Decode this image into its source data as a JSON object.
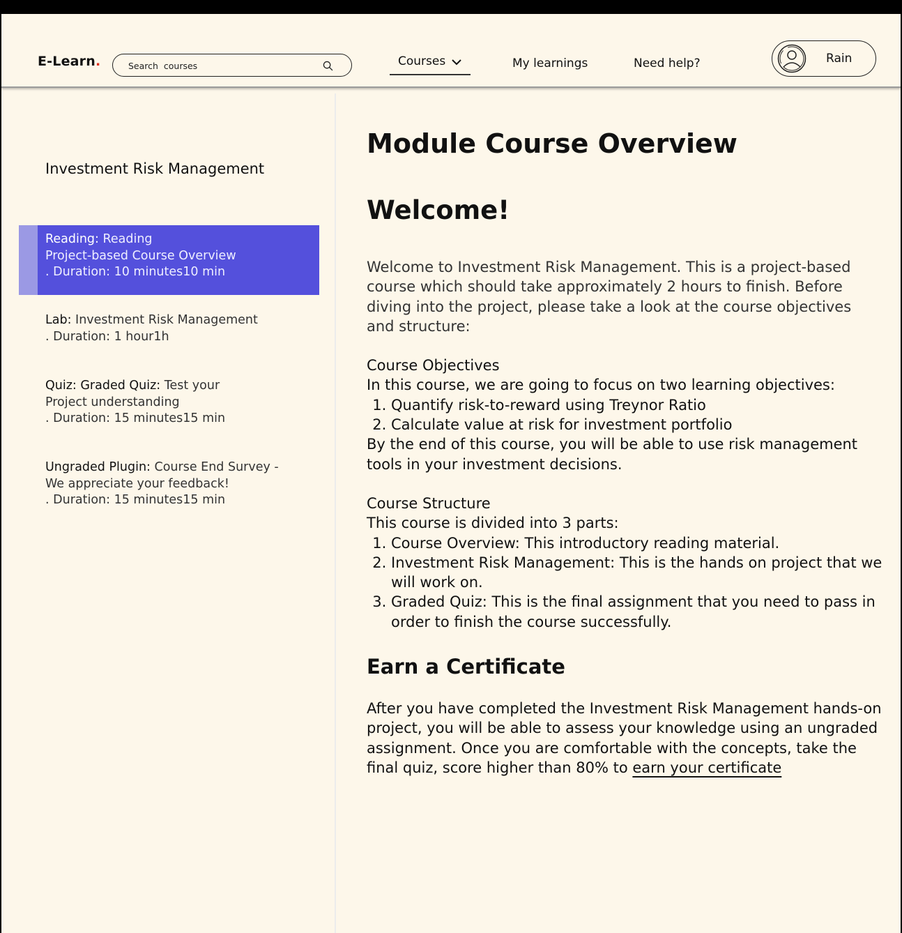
{
  "header": {
    "logo": "E-Learn",
    "logo_dot": ".",
    "search_placeholder": "Search  courses",
    "nav": {
      "courses": "Courses",
      "my_learnings": "My learnings",
      "need_help": "Need help?"
    },
    "user_name": "Rain"
  },
  "sidebar": {
    "course_title": "Investment Risk Management",
    "items": [
      {
        "label": "Reading:",
        "text": " Reading\nProject-based Course Overview\n. Duration: 10 minutes10 min",
        "active": true
      },
      {
        "label": "Lab:",
        "text": " Investment Risk Management\n. Duration: 1 hour1h",
        "active": false
      },
      {
        "label": "Quiz: Graded Quiz:",
        "text": " Test your\nProject understanding\n. Duration: 15 minutes15 min",
        "active": false
      },
      {
        "label": "Ungraded Plugin:",
        "text": " Course End Survey -\n We appreciate your feedback!\n. Duration: 15 minutes15 min",
        "active": false
      }
    ]
  },
  "main": {
    "page_title": "Module Course Overview",
    "welcome_heading": "Welcome!",
    "intro": "Welcome to Investment Risk Management. This is a project-based course which should take approximately 2 hours to finish. Before diving into the project, please take a look at the course objectives and structure:",
    "objectives": {
      "heading": "Course Objectives",
      "lead": "In this course, we are going to focus on two learning objectives:",
      "items": [
        "Quantify risk-to-reward using Treynor Ratio",
        "Calculate value at risk for investment portfolio"
      ],
      "closing": "By the end of this course, you will be able to use risk management tools in your investment decisions."
    },
    "structure": {
      "heading": "Course Structure",
      "lead": "This course is divided into 3 parts:",
      "items": [
        "Course Overview: This introductory reading material.",
        "Investment Risk Management: This is the hands on project that we will work on.",
        "Graded Quiz: This is the final assignment that you need to pass in order to finish the course successfully."
      ]
    },
    "certificate": {
      "heading": "Earn a Certificate",
      "body": "After you have completed the Investment Risk Management hands-on project, you will be able to assess your knowledge using an ungraded assignment. Once you are comfortable with the concepts, take the final quiz, score higher than 80% to ",
      "link": "earn your certificate"
    }
  }
}
